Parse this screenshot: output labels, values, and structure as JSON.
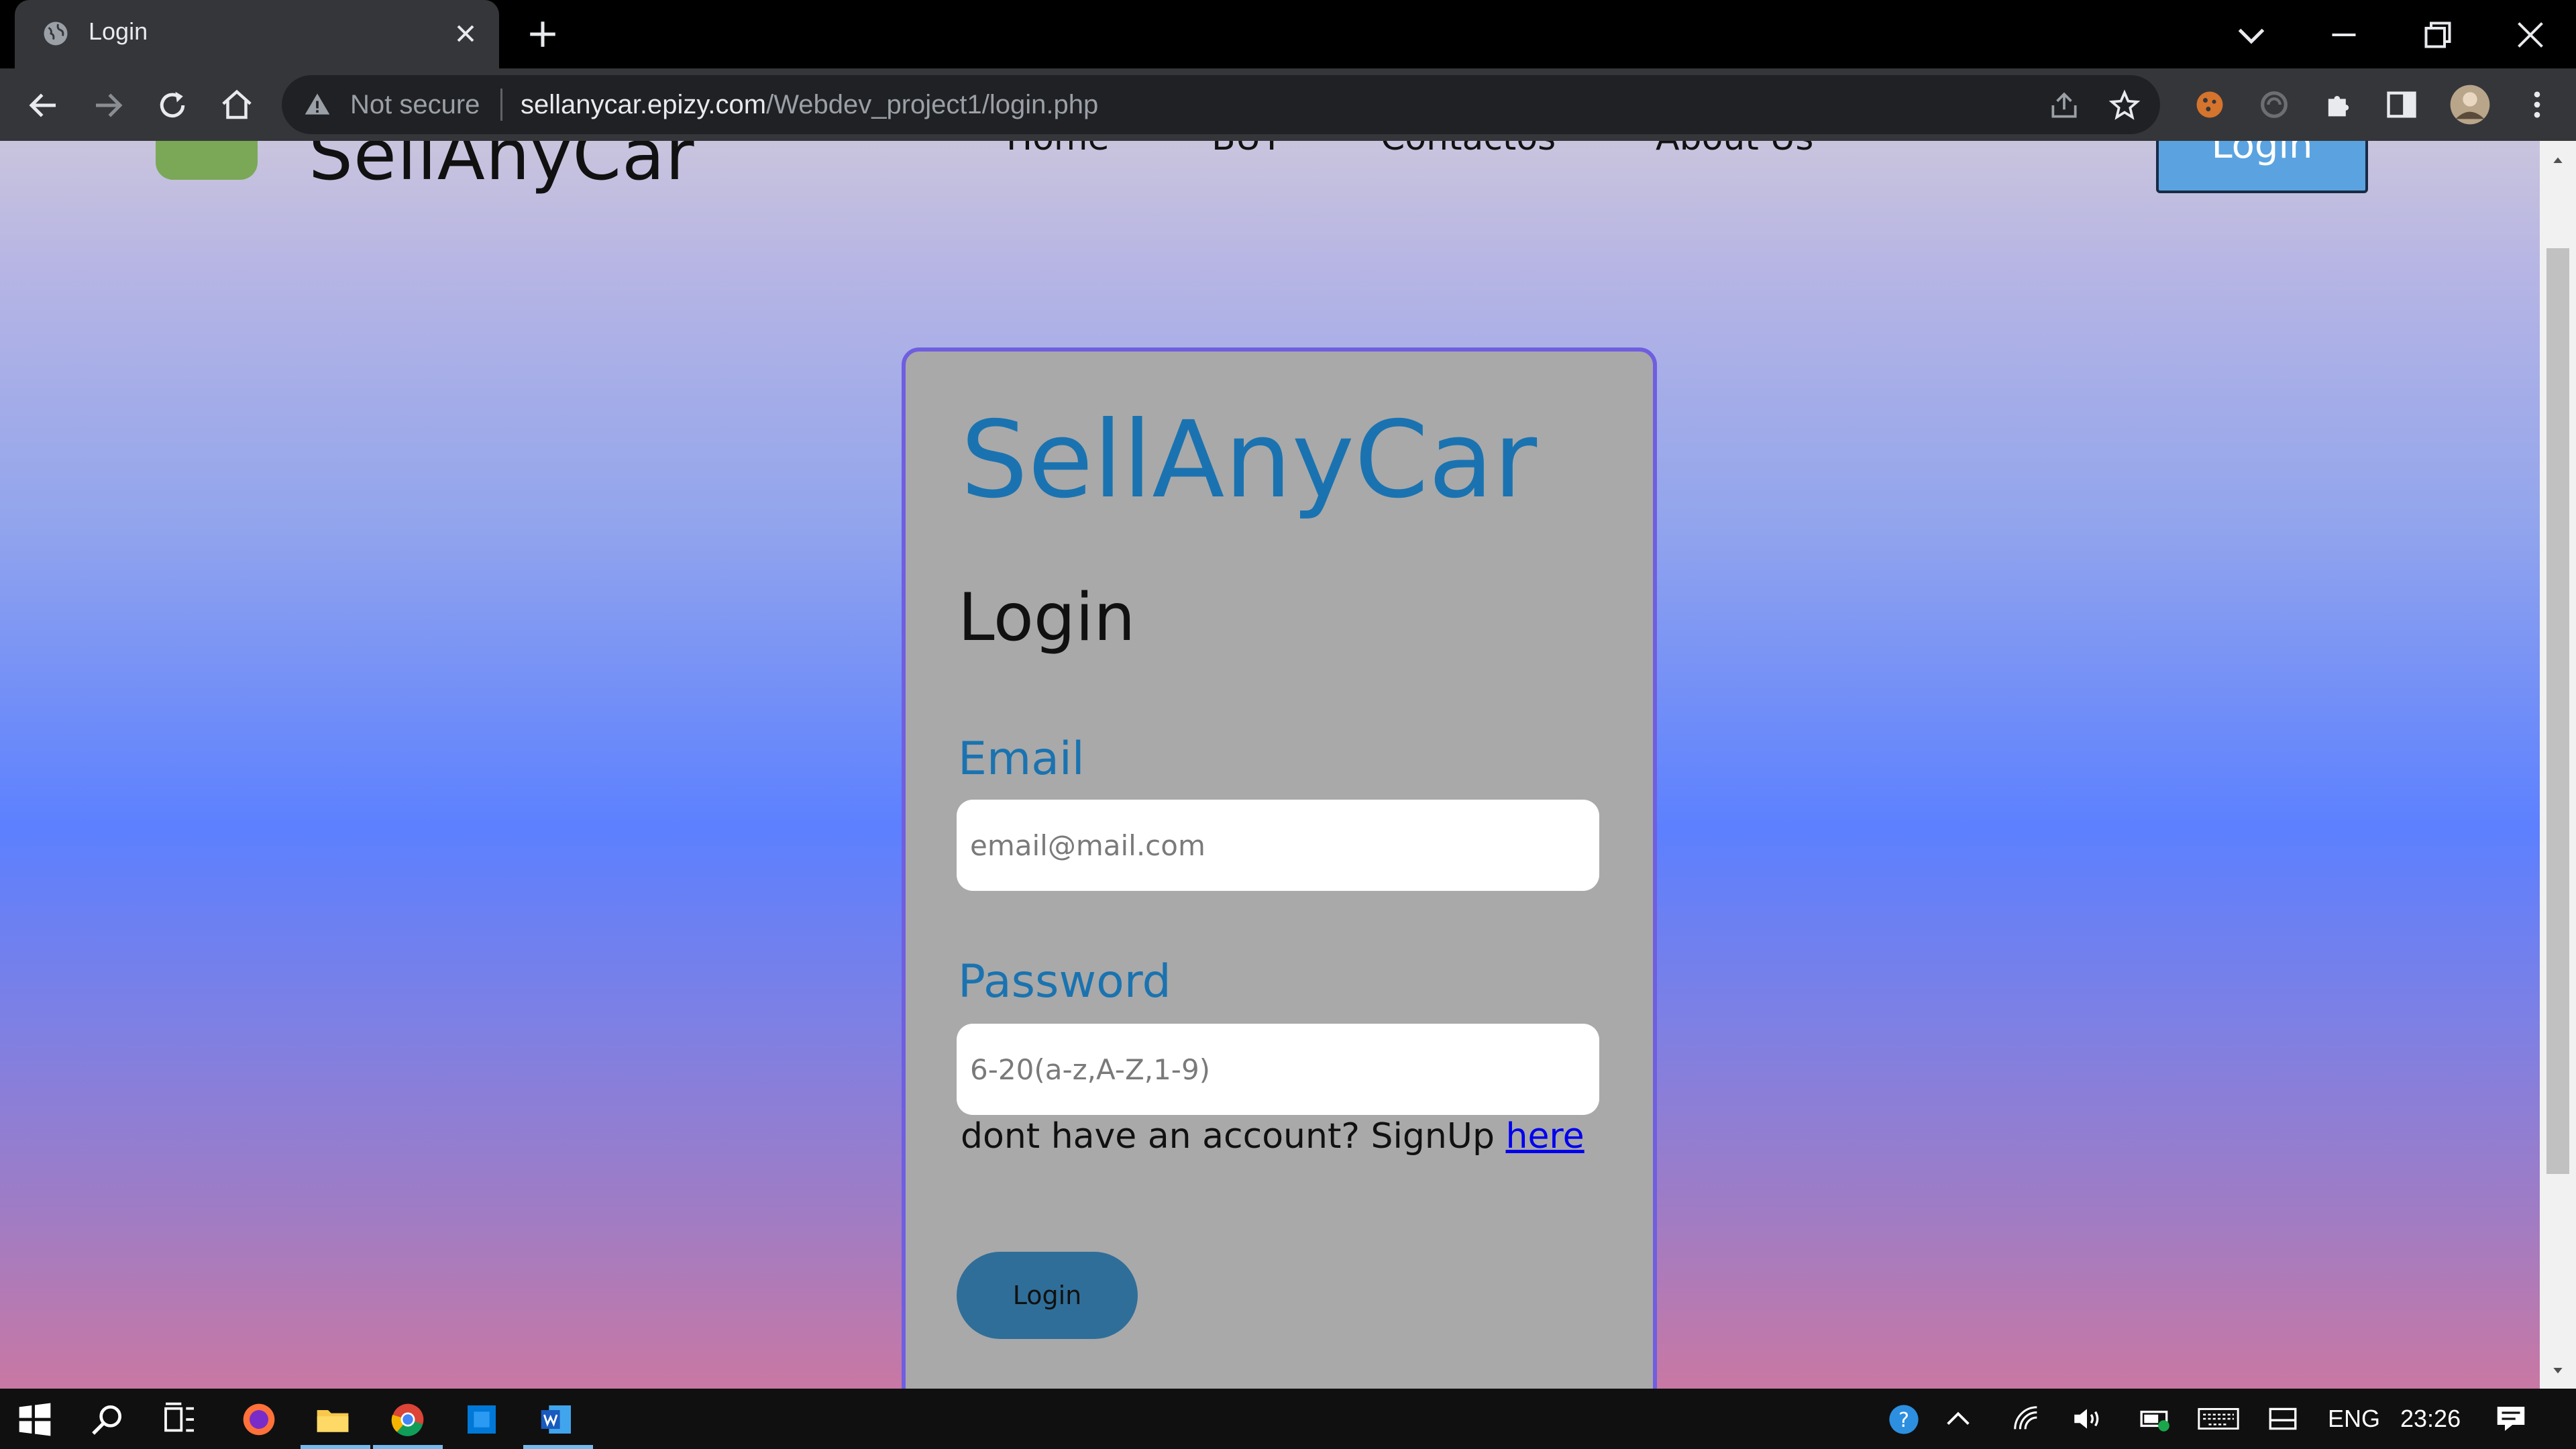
{
  "browser": {
    "tab_title": "Login",
    "security_label": "Not secure",
    "url_host": "sellanycar.epizy.com",
    "url_path": "/Webdev_project1/login.php"
  },
  "site": {
    "brand": "SellAnyCar",
    "nav": [
      "Home",
      "BUY",
      "Contactos",
      "About Us"
    ],
    "header_login": "Login"
  },
  "login_card": {
    "brand": "SellAnyCar",
    "heading": "Login",
    "email_label": "Email",
    "email_placeholder": "email@mail.com",
    "password_label": "Password",
    "password_placeholder": "6-20(a-z,A-Z,1-9)",
    "signup_text": "dont have an account? SignUp ",
    "signup_link": "here",
    "submit_label": "Login"
  },
  "taskbar": {
    "language": "ENG",
    "time": "23:26"
  },
  "colors": {
    "brand_blue": "#1a73b0",
    "card_border": "#6f5ee0",
    "button": "#2f6e99"
  }
}
